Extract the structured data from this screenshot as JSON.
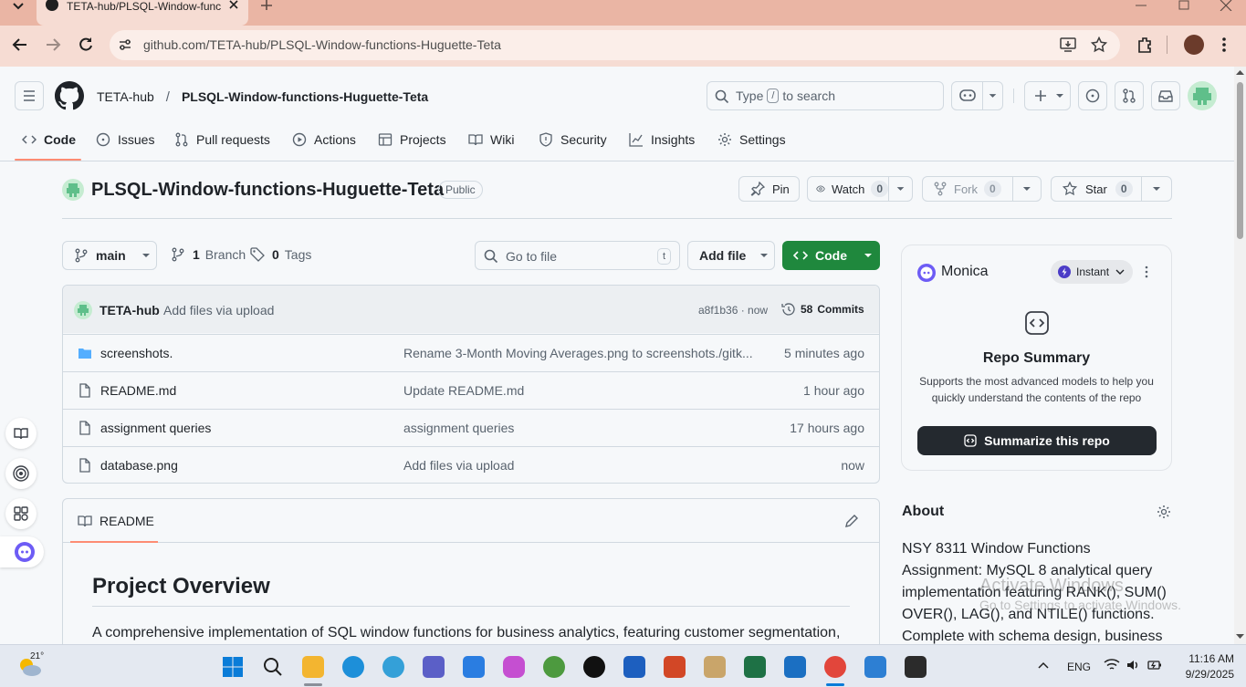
{
  "browser": {
    "tab_title": "TETA-hub/PLSQL-Window-func",
    "url": "github.com/TETA-hub/PLSQL-Window-functions-Huguette-Teta"
  },
  "header": {
    "owner": "TETA-hub",
    "slash": "/",
    "repo": "PLSQL-Window-functions-Huguette-Teta",
    "search_type": "Type",
    "search_key": "/",
    "search_rest": "to search"
  },
  "nav": {
    "code": "Code",
    "issues": "Issues",
    "pulls": "Pull requests",
    "actions": "Actions",
    "projects": "Projects",
    "wiki": "Wiki",
    "security": "Security",
    "insights": "Insights",
    "settings": "Settings"
  },
  "repo": {
    "title": "PLSQL-Window-functions-Huguette-Teta",
    "visibility": "Public",
    "pin": "Pin",
    "watch": "Watch",
    "watch_count": "0",
    "fork": "Fork",
    "fork_count": "0",
    "star": "Star",
    "star_count": "0"
  },
  "toolbar": {
    "branch": "main",
    "branches_count": "1",
    "branches_label": "Branch",
    "tags_count": "0",
    "tags_label": "Tags",
    "go_to_file": "Go to file",
    "go_key": "t",
    "add_file": "Add file",
    "code": "Code"
  },
  "commit": {
    "author": "TETA-hub",
    "message": "Add files via upload",
    "hash": "a8f1b36 · now",
    "commits_count": "58",
    "commits_label": "Commits"
  },
  "files": [
    {
      "name": "screenshots.",
      "message": "Rename 3-Month Moving Averages.png to screenshots./gitk...",
      "time": "5 minutes ago",
      "type": "folder"
    },
    {
      "name": "README.md",
      "message": "Update README.md",
      "time": "1 hour ago",
      "type": "file"
    },
    {
      "name": "assignment queries",
      "message": "assignment queries",
      "time": "17 hours ago",
      "type": "file"
    },
    {
      "name": "database.png",
      "message": "Add files via upload",
      "time": "now",
      "type": "file"
    }
  ],
  "readme": {
    "tab": "README",
    "heading": "Project Overview",
    "text": "A comprehensive implementation of SQL window functions for business analytics, featuring customer segmentation,"
  },
  "monica": {
    "name": "Monica",
    "mode": "Instant",
    "summary_title": "Repo Summary",
    "summary_desc": "Supports the most advanced models to help you quickly understand the contents of the repo",
    "summarize_button": "Summarize this repo"
  },
  "about": {
    "title": "About",
    "description": "NSY 8311 Window Functions Assignment: MySQL 8 analytical query implementation featuring RANK(), SUM() OVER(), LAG(), and NTILE() functions. Complete with schema design, business analysis, and"
  },
  "watermark": {
    "line1": "Activate Windows",
    "line2": "Go to Settings to activate Windows."
  },
  "taskbar": {
    "weather_temp": "21°",
    "lang": "ENG",
    "time": "11:16 AM",
    "date": "9/29/2025"
  },
  "colors": {
    "green": "#1f883d",
    "accent_underline": "#fd8c73",
    "link": "#0969da",
    "monica_dark": "#24292f"
  }
}
